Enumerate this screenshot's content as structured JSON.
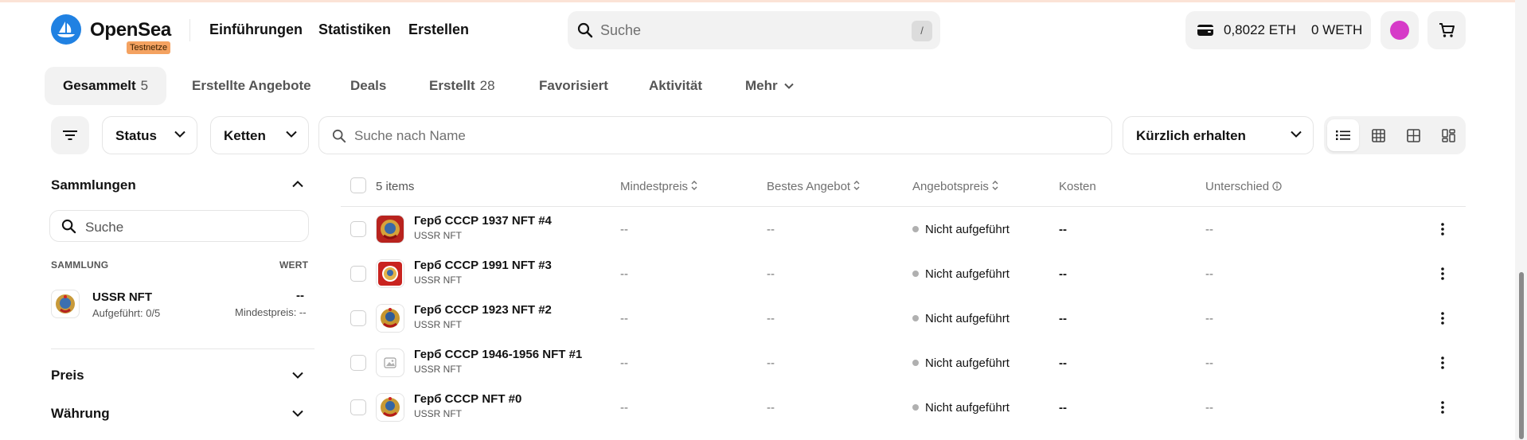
{
  "header": {
    "brand": "OpenSea",
    "badge": "Testnetze",
    "nav": [
      "Einführungen",
      "Statistiken",
      "Erstellen"
    ],
    "search_placeholder": "Suche",
    "search_shortcut": "/",
    "wallet_eth": "0,8022 ETH",
    "wallet_weth": "0 WETH",
    "accent_color": "#2081e2",
    "avatar_color": "#d63ac8"
  },
  "tabs": [
    {
      "label": "Gesammelt",
      "count": "5"
    },
    {
      "label": "Erstellte Angebote",
      "count": ""
    },
    {
      "label": "Deals",
      "count": ""
    },
    {
      "label": "Erstellt",
      "count": "28"
    },
    {
      "label": "Favorisiert",
      "count": ""
    },
    {
      "label": "Aktivität",
      "count": ""
    },
    {
      "label": "Mehr",
      "count": ""
    }
  ],
  "filters": {
    "status": "Status",
    "chains": "Ketten",
    "name_placeholder": "Suche nach Name",
    "sort": "Kürzlich erhalten"
  },
  "sidebar": {
    "collections_title": "Sammlungen",
    "search_placeholder": "Suche",
    "col_collection": "SAMMLUNG",
    "col_value": "WERT",
    "collection": {
      "name": "USSR NFT",
      "listed": "Aufgeführt: 0/5",
      "value": "--",
      "floor": "Mindestpreis: --"
    },
    "price": "Preis",
    "currency": "Währung"
  },
  "table": {
    "items_count": "5 items",
    "headers": {
      "floor": "Mindestpreis",
      "best_offer": "Bestes Angebot",
      "listing_price": "Angebotspreis",
      "cost": "Kosten",
      "difference": "Unterschied"
    },
    "rows": [
      {
        "name": "Герб СССР 1937 NFT #4",
        "collection": "USSR NFT",
        "floor": "--",
        "best_offer": "--",
        "listing": "Nicht aufgeführt",
        "cost": "--",
        "diff": "--"
      },
      {
        "name": "Герб СССР 1991 NFT #3",
        "collection": "USSR NFT",
        "floor": "--",
        "best_offer": "--",
        "listing": "Nicht aufgeführt",
        "cost": "--",
        "diff": "--"
      },
      {
        "name": "Герб СССР 1923 NFT #2",
        "collection": "USSR NFT",
        "floor": "--",
        "best_offer": "--",
        "listing": "Nicht aufgeführt",
        "cost": "--",
        "diff": "--"
      },
      {
        "name": "Герб СССР 1946-1956 NFT #1",
        "collection": "USSR NFT",
        "floor": "--",
        "best_offer": "--",
        "listing": "Nicht aufgeführt",
        "cost": "--",
        "diff": "--"
      },
      {
        "name": "Герб СССР NFT #0",
        "collection": "USSR NFT",
        "floor": "--",
        "best_offer": "--",
        "listing": "Nicht aufgeführt",
        "cost": "--",
        "diff": "--"
      }
    ]
  }
}
